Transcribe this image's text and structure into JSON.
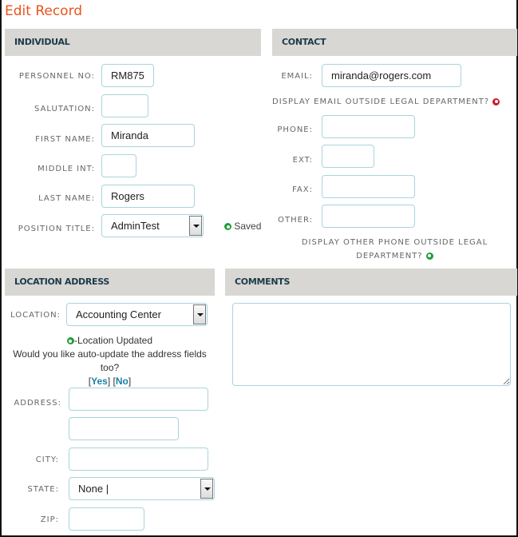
{
  "page": {
    "title": "Edit Record"
  },
  "individual": {
    "header": "INDIVIDUAL",
    "fields": {
      "personnel_no": {
        "label": "PERSONNEL NO:",
        "value": "RM875"
      },
      "salutation": {
        "label": "SALUTATION:",
        "value": ""
      },
      "first_name": {
        "label": "FIRST NAME:",
        "value": "Miranda"
      },
      "middle_int": {
        "label": "MIDDLE INT:",
        "value": ""
      },
      "last_name": {
        "label": "LAST NAME:",
        "value": "Rogers"
      },
      "position_title": {
        "label": "POSITION TITLE:",
        "value": "AdminTest"
      }
    },
    "status": {
      "text": "Saved",
      "icon": "green-dot-icon",
      "color": "#1e9e3a"
    }
  },
  "contact": {
    "header": "CONTACT",
    "fields": {
      "email": {
        "label": "EMAIL:",
        "value": "miranda@rogers.com"
      },
      "phone": {
        "label": "PHONE:",
        "value": ""
      },
      "ext": {
        "label": "EXT:",
        "value": ""
      },
      "fax": {
        "label": "FAX:",
        "value": ""
      },
      "other": {
        "label": "OTHER:",
        "value": ""
      }
    },
    "display_email": {
      "text": "DISPLAY EMAIL OUTSIDE LEGAL DEPARTMENT?",
      "state": "off",
      "color": "#cc1a2a"
    },
    "display_other_line1": "DISPLAY OTHER PHONE OUTSIDE LEGAL",
    "display_other_line2": "DEPARTMENT?",
    "display_other_state": {
      "state": "on",
      "color": "#1e9e3a"
    }
  },
  "location": {
    "header": "LOCATION ADDRESS",
    "fields": {
      "location": {
        "label": "LOCATION:",
        "value": "Accounting Center"
      },
      "address": {
        "label": "ADDRESS:",
        "value": ""
      },
      "address2": {
        "value": ""
      },
      "city": {
        "label": "CITY:",
        "value": ""
      },
      "state": {
        "label": "STATE:",
        "value": "None |"
      },
      "zip": {
        "label": "ZIP:",
        "value": ""
      }
    },
    "updated_msg": "-Location Updated",
    "prompt_line1": "Would you like auto-update the address fields",
    "prompt_line2": "too?",
    "yes_label": "Yes",
    "no_label": "No"
  },
  "comments": {
    "header": "COMMENTS",
    "value": ""
  },
  "colors": {
    "accent": "#e8541c",
    "header_bg": "#d8d7d3",
    "header_text": "#1b3a4a",
    "input_border": "#a9d4dc",
    "link": "#1a7fa6"
  }
}
